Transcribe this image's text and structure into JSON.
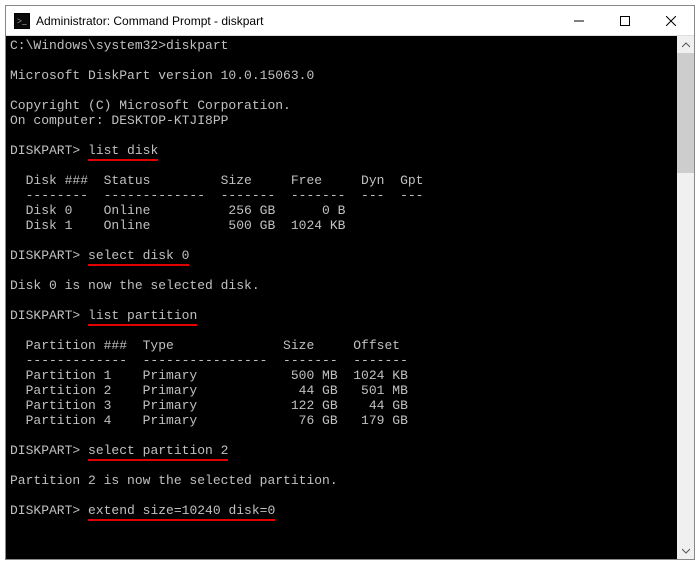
{
  "window": {
    "title": "Administrator: Command Prompt - diskpart"
  },
  "prompt_path": "C:\\Windows\\system32>",
  "cmd_initial": "diskpart",
  "version_line": "Microsoft DiskPart version 10.0.15063.0",
  "copyright_line": "Copyright (C) Microsoft Corporation.",
  "computer_label": "On computer: ",
  "computer_name": "DESKTOP-KTJI8PP",
  "dp_prompt": "DISKPART>",
  "cmd_list_disk": "list disk",
  "disk_header": "  Disk ###  Status         Size     Free     Dyn  Gpt",
  "disk_sep": "  --------  -------------  -------  -------  ---  ---",
  "disks": [
    {
      "line": "  Disk 0    Online          256 GB      0 B"
    },
    {
      "line": "  Disk 1    Online          500 GB  1024 KB"
    }
  ],
  "cmd_select_disk": "select disk 0",
  "msg_select_disk": "Disk 0 is now the selected disk.",
  "cmd_list_part": "list partition",
  "part_header": "  Partition ###  Type              Size     Offset",
  "part_sep": "  -------------  ----------------  -------  -------",
  "partitions": [
    {
      "line": "  Partition 1    Primary            500 MB  1024 KB"
    },
    {
      "line": "  Partition 2    Primary             44 GB   501 MB"
    },
    {
      "line": "  Partition 3    Primary            122 GB    44 GB"
    },
    {
      "line": "  Partition 4    Primary             76 GB   179 GB"
    }
  ],
  "cmd_select_part": "select partition 2",
  "msg_select_part": "Partition 2 is now the selected partition.",
  "cmd_extend": "extend size=10240 disk=0"
}
